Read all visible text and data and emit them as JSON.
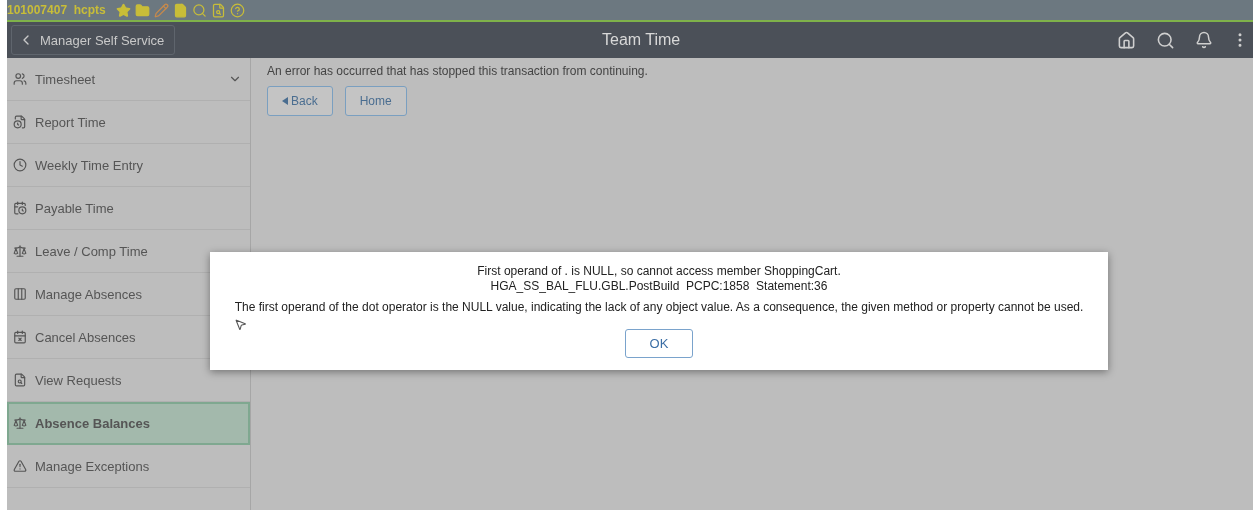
{
  "top_strip": {
    "user": "101007407  hcpts"
  },
  "header": {
    "back_button": "Manager Self Service",
    "title": "Team Time"
  },
  "sidebar": {
    "items": [
      {
        "label": "Timesheet",
        "selected": false,
        "expandable": true
      },
      {
        "label": "Report Time",
        "selected": false,
        "expandable": false
      },
      {
        "label": "Weekly Time Entry",
        "selected": false,
        "expandable": false
      },
      {
        "label": "Payable Time",
        "selected": false,
        "expandable": false
      },
      {
        "label": "Leave / Comp Time",
        "selected": false,
        "expandable": false
      },
      {
        "label": "Manage Absences",
        "selected": false,
        "expandable": false
      },
      {
        "label": "Cancel Absences",
        "selected": false,
        "expandable": false
      },
      {
        "label": "View Requests",
        "selected": false,
        "expandable": false
      },
      {
        "label": "Absence Balances",
        "selected": true,
        "expandable": false
      },
      {
        "label": "Manage Exceptions",
        "selected": false,
        "expandable": false
      }
    ]
  },
  "content": {
    "message": "An error has occurred that has stopped this transaction from continuing.",
    "buttons": [
      {
        "label": "Back",
        "kind": "back"
      },
      {
        "label": "Home",
        "kind": "plain"
      }
    ]
  },
  "dialog": {
    "lines": [
      "First operand of . is NULL, so cannot access member ShoppingCart.",
      "HGA_SS_BAL_FLU.GBL.PostBuild  PCPC:1858  Statement:36"
    ],
    "detail": "The first operand of the dot operator is the NULL value, indicating the lack of any object value. As a consequence, the given method or property cannot be used.",
    "ok": "OK"
  }
}
